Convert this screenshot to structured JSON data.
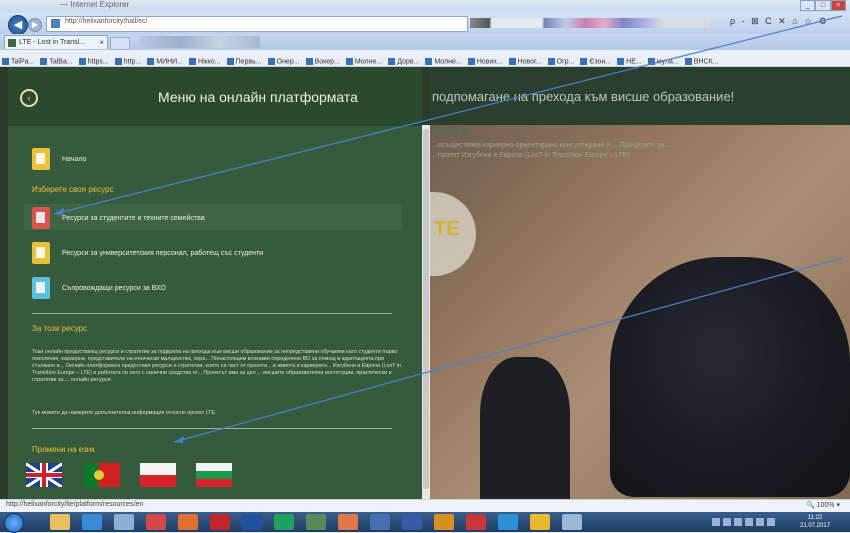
{
  "browser": {
    "window_title": "— Internet Explorer",
    "url": "http://helixanforcity/hall/ec/",
    "tab_title": "LTE - Lost in Transl...",
    "window_buttons": [
      "_",
      "□",
      "×"
    ],
    "nav_icons": "ρ - ⊠ C ✕ ⌂ ☆ ⚙",
    "favorites": [
      "TalPa...",
      "TalBa...",
      "https...",
      "http...",
      "МИНИ...",
      "Нікко...",
      "Первь...",
      "Онер...",
      "Вокер...",
      "Молне...",
      "Дорв...",
      "Молне...",
      "Нових...",
      "Новог...",
      "Огр...",
      "Єзон...",
      "HE...",
      "мула...",
      "ВНСК..."
    ]
  },
  "panel": {
    "title": "Меню на онлайн платформата",
    "close_icon": "‹",
    "home_label": "Начало",
    "select_heading": "Изберете своя ресурс",
    "resources": [
      {
        "label": "Ресурси за студентите и техните семейства",
        "color": "#d9534f"
      },
      {
        "label": "Ресурси за университетския персонал, работещ със студенти",
        "color": "#e9c13c"
      },
      {
        "label": "Съпровождащи ресурси за ВХО",
        "color": "#5bc0de"
      }
    ],
    "about_heading": "За този ресурс",
    "about_text": "Този онлайн предоставящ ресурси и стратегии за подкрепа на прехода към висше образование за непредставени обучаеми като студенти първо поколение, кариерни, представители на етнически малцинства, хора... Понастоящем всякакви определени ВО за помощ в адаптацията при стъпване в... Онлайн платформата предоставя ресурси и стратегии, които са част от проекта ...в живота и кариерата... Изгубени в Европа (LosT in TransItion Europe – LTE) и работата по него с налични средства от... Проектът има за цел ... висшите образователни институции, практически и стратегии за ... онлайн ресурси.",
    "about_more": "Тук можете да намерите допълнителна информация относно проект LTE.",
    "language_heading": "Промени на език",
    "languages": [
      "English",
      "Português",
      "Polski",
      "Български"
    ]
  },
  "content": {
    "header_title": "подпомагане на прехода към висше образование!",
    "intro": "...осъществява кариерно-ориентирано консултиране и ... Процесите за...\n...проект Изгубени в Европа (LosT in TransItion Europe – LTE)",
    "logo_text": "TE"
  },
  "statusbar": {
    "url": "http://helixanforcity/lte/platform/resources/en",
    "zoom": "🔍 100% ▾"
  },
  "taskbar": {
    "clock": "11:22\n21.07.2017"
  },
  "colors": {
    "panel_bg": "#365a3c",
    "accent": "#e9c13c",
    "arrow": "#4a7fd0"
  }
}
